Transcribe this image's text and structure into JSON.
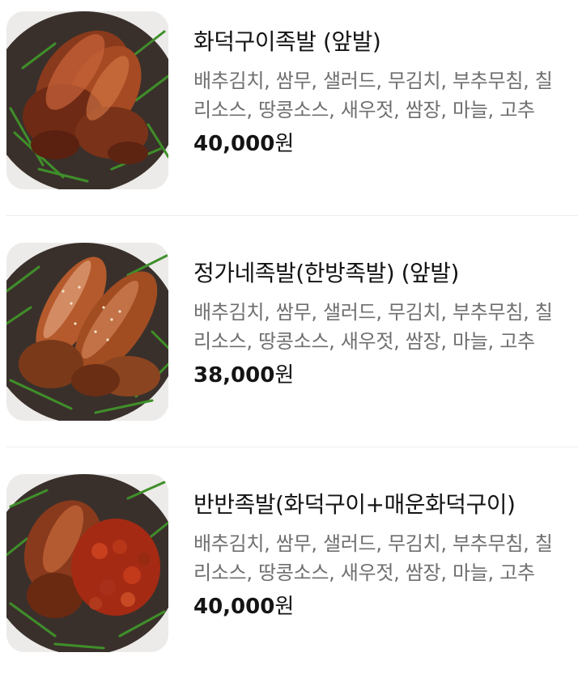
{
  "menu": {
    "items": [
      {
        "name": "화덕구이족발 (앞발)",
        "description": "배추김치, 쌈무, 샐러드, 무김치, 부추무침, 칠리소스, 땅콩소스, 새우젓, 쌈장, 마늘, 고추",
        "price": "40,000",
        "currency": "원",
        "image_icon": "food-photo"
      },
      {
        "name": "정가네족발(한방족발) (앞발)",
        "description": "배추김치, 쌈무, 샐러드, 무김치, 부추무침, 칠리소스, 땅콩소스, 새우젓, 쌈장, 마늘, 고추",
        "price": "38,000",
        "currency": "원",
        "image_icon": "food-photo"
      },
      {
        "name": "반반족발(화덕구이+매운화덕구이)",
        "description": "배추김치, 쌈무, 샐러드, 무김치, 부추무침, 칠리소스, 땅콩소스, 새우젓, 쌈장, 마늘, 고추",
        "price": "40,000",
        "currency": "원",
        "image_icon": "food-photo"
      }
    ]
  },
  "colors": {
    "name_text": "#141414",
    "desc_text": "#6f6f6f",
    "divider": "#eeeeee",
    "plate": "#3a302b",
    "chive": "#3f8f2a"
  }
}
